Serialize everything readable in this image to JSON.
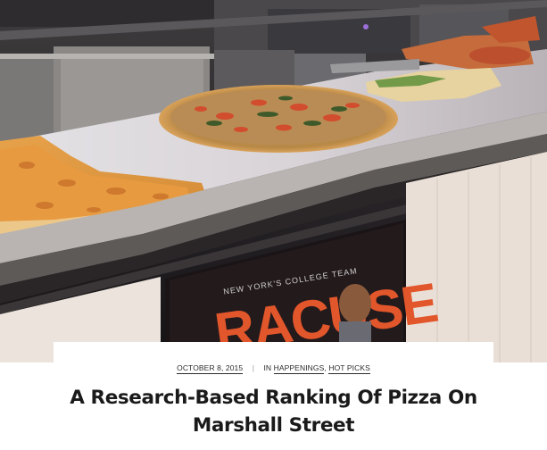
{
  "hero": {
    "image_subject": "pizza-display-case",
    "banner_text": "NEW YORK'S COLLEGE TEAM",
    "banner_big": "RACUSE",
    "colors": {
      "crust": "#d9a15a",
      "sauce": "#c2402a",
      "case_steel": "#6d6a66",
      "banner_orange": "#e2562b"
    }
  },
  "post": {
    "date": "OCTOBER 8, 2015",
    "separator": "|",
    "category_prefix": "IN",
    "categories": [
      "HAPPENINGS",
      "HOT PICKS"
    ],
    "category_joiner": ",",
    "title_line1": "A Research-Based Ranking Of Pizza On",
    "title_line2": "Marshall Street"
  }
}
